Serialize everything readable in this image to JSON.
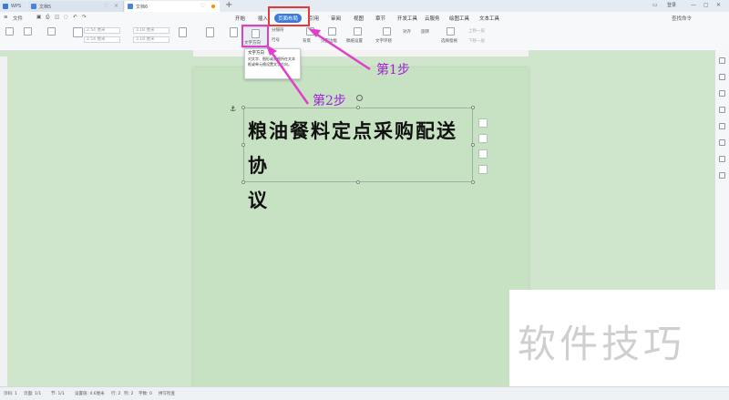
{
  "titlebar": {
    "tabs": [
      {
        "label": "WPS"
      },
      {
        "label": "文档5"
      },
      {
        "label": "文档6"
      }
    ],
    "login": "登录"
  },
  "menubar": {
    "quick": [
      "文件"
    ],
    "items": [
      "开始",
      "插入",
      "页面布局",
      "引用",
      "审阅",
      "视图",
      "章节",
      "开发工具",
      "云服务",
      "绘图工具",
      "文本工具"
    ],
    "active_index": 2
  },
  "ribbon": {
    "text_direction": "文字方向",
    "tab_stops": "分隔符",
    "line_number": "行号",
    "background": "背景",
    "page_border": "页面边框",
    "watermark": "稿纸设置",
    "text_wrap": "文字环绕",
    "align": "对齐",
    "rotate": "旋转",
    "select_pane": "选择窗格",
    "up_one": "上移一层",
    "down_one": "下移一层",
    "search": "查找命令",
    "page_margin_top": "2.54 厘米",
    "page_margin_bottom": "2.54 厘米",
    "page_margin_left": "3.18 厘米",
    "page_margin_right": "3.18 厘米"
  },
  "tooltip": {
    "title": "文字方向",
    "body": "对文字、图形或表格所在文本框或单元格设置文字方向。"
  },
  "document": {
    "title_line1": "粮油餐料定点采购配送协",
    "title_line2": "议"
  },
  "annotations": {
    "step1": "第1步",
    "step2": "第2步"
  },
  "watermark": "软件技巧",
  "statusbar": {
    "page": "页码: 1",
    "pages": "页面: 1/1",
    "section": "节: 1/1",
    "position": "设置值: 4.6厘米",
    "row": "行: 2",
    "col": "列: 2",
    "words": "字数: 0",
    "spell": "拼写检查"
  },
  "colors": {
    "highlight_box": "#e53935",
    "annotation": "#a020d8",
    "pointer": "#e040c8",
    "active_tab": "#3b7bd6",
    "page_bg": "#c7e2c2"
  }
}
